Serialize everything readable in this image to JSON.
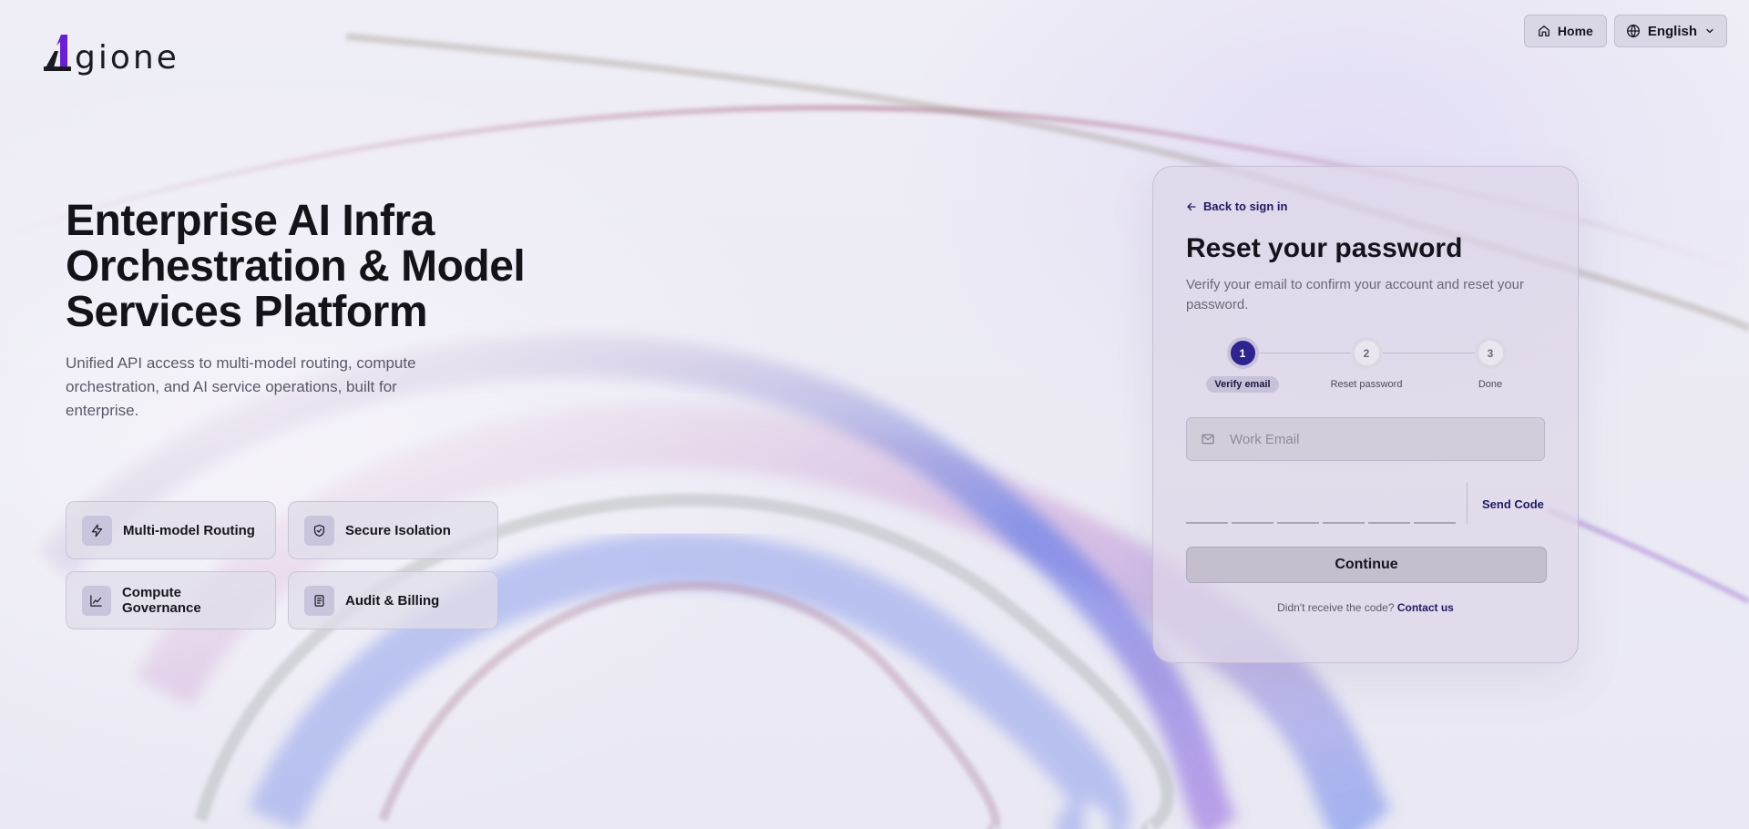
{
  "brand": {
    "logo_text": "gione"
  },
  "header": {
    "home_label": "Home",
    "language_label": "English"
  },
  "hero": {
    "title": "Enterprise AI Infra Orchestration & Model Services Platform",
    "subtitle": "Unified API access to multi-model routing, compute orchestration, and AI service operations, built for enterprise.",
    "features": [
      {
        "label": "Multi-model Routing",
        "icon": "lightning-icon"
      },
      {
        "label": "Secure Isolation",
        "icon": "shield-icon"
      },
      {
        "label": "Compute Governance",
        "icon": "chart-icon"
      },
      {
        "label": "Audit & Billing",
        "icon": "document-icon"
      }
    ]
  },
  "card": {
    "back_label": "Back to sign in",
    "title": "Reset your password",
    "description": "Verify your email to confirm your account and reset your password.",
    "steps": [
      {
        "number": "1",
        "label": "Verify email",
        "active": true
      },
      {
        "number": "2",
        "label": "Reset password",
        "active": false
      },
      {
        "number": "3",
        "label": "Done",
        "active": false
      }
    ],
    "email_placeholder": "Work Email",
    "email_value": "",
    "code_length": 6,
    "send_code_label": "Send Code",
    "continue_label": "Continue",
    "help_text": "Didn't receive the code?",
    "contact_label": "Contact us"
  },
  "colors": {
    "accent": "#2d248f",
    "link": "#1f1a62"
  }
}
